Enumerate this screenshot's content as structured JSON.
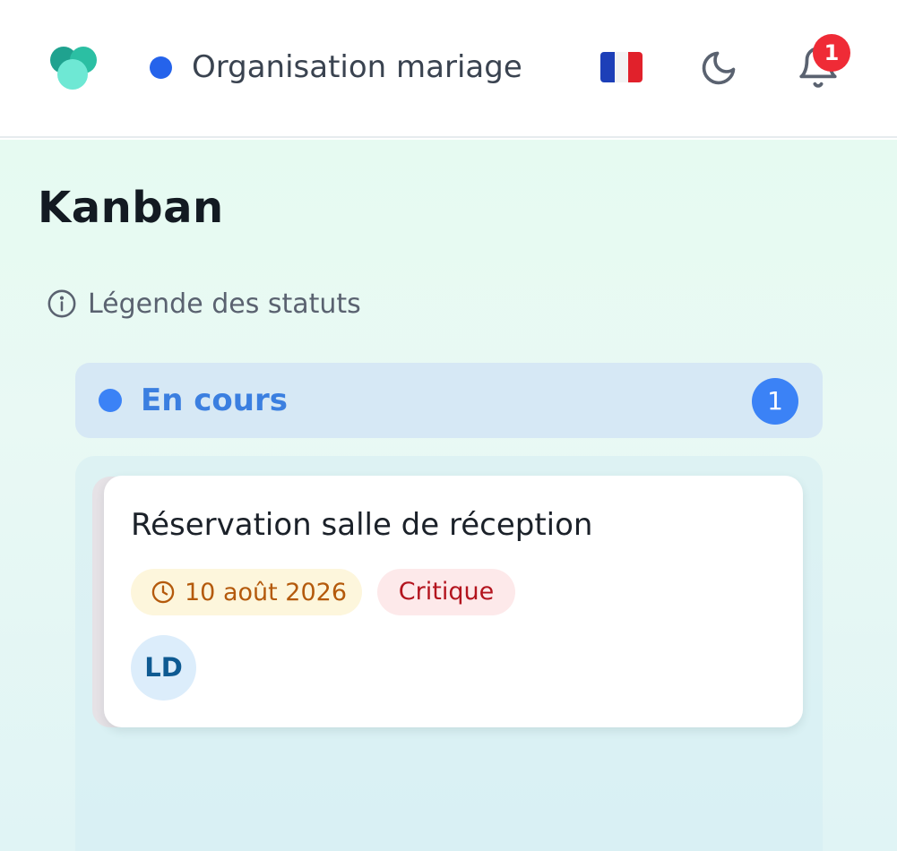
{
  "header": {
    "logo_icon": "app-logo-icon",
    "project_name": "Organisation mariage",
    "project_dot_color": "#2563eb",
    "language_icon": "flag-fr-icon",
    "theme_icon": "moon-icon",
    "notifications_icon": "bell-icon",
    "notification_count": "1"
  },
  "main": {
    "title": "Kanban",
    "legend_icon": "info-icon",
    "legend_label": "Légende des statuts",
    "column": {
      "title": "En cours",
      "count": "1",
      "color": "#3b82f6",
      "cards": [
        {
          "title": "Réservation salle de réception",
          "date_icon": "clock-icon",
          "date": "10 août 2026",
          "priority": "Critique",
          "assignee_initials": "LD"
        }
      ]
    }
  }
}
